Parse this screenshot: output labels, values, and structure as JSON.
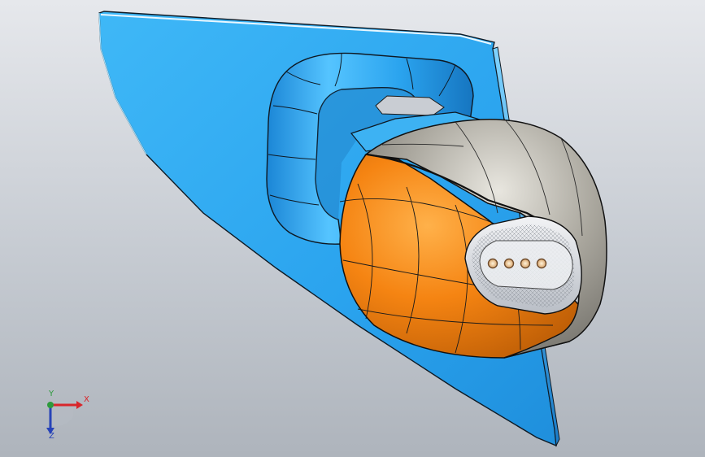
{
  "viewport": {
    "background_top": "#e6e8ec",
    "background_bottom": "#aeb4bc"
  },
  "model": {
    "mount_plate_color": "#2ea9f2",
    "mirror_cap_color": "#f07e10",
    "housing_color": "#9c9a92",
    "lens_color": "#d8dce2",
    "edge_color": "#111111"
  },
  "triad": {
    "x_label": "X",
    "y_label": "Y",
    "z_label": "Z",
    "x_color": "#d8262b",
    "y_color": "#2d9a3c",
    "z_color": "#2743b8"
  }
}
